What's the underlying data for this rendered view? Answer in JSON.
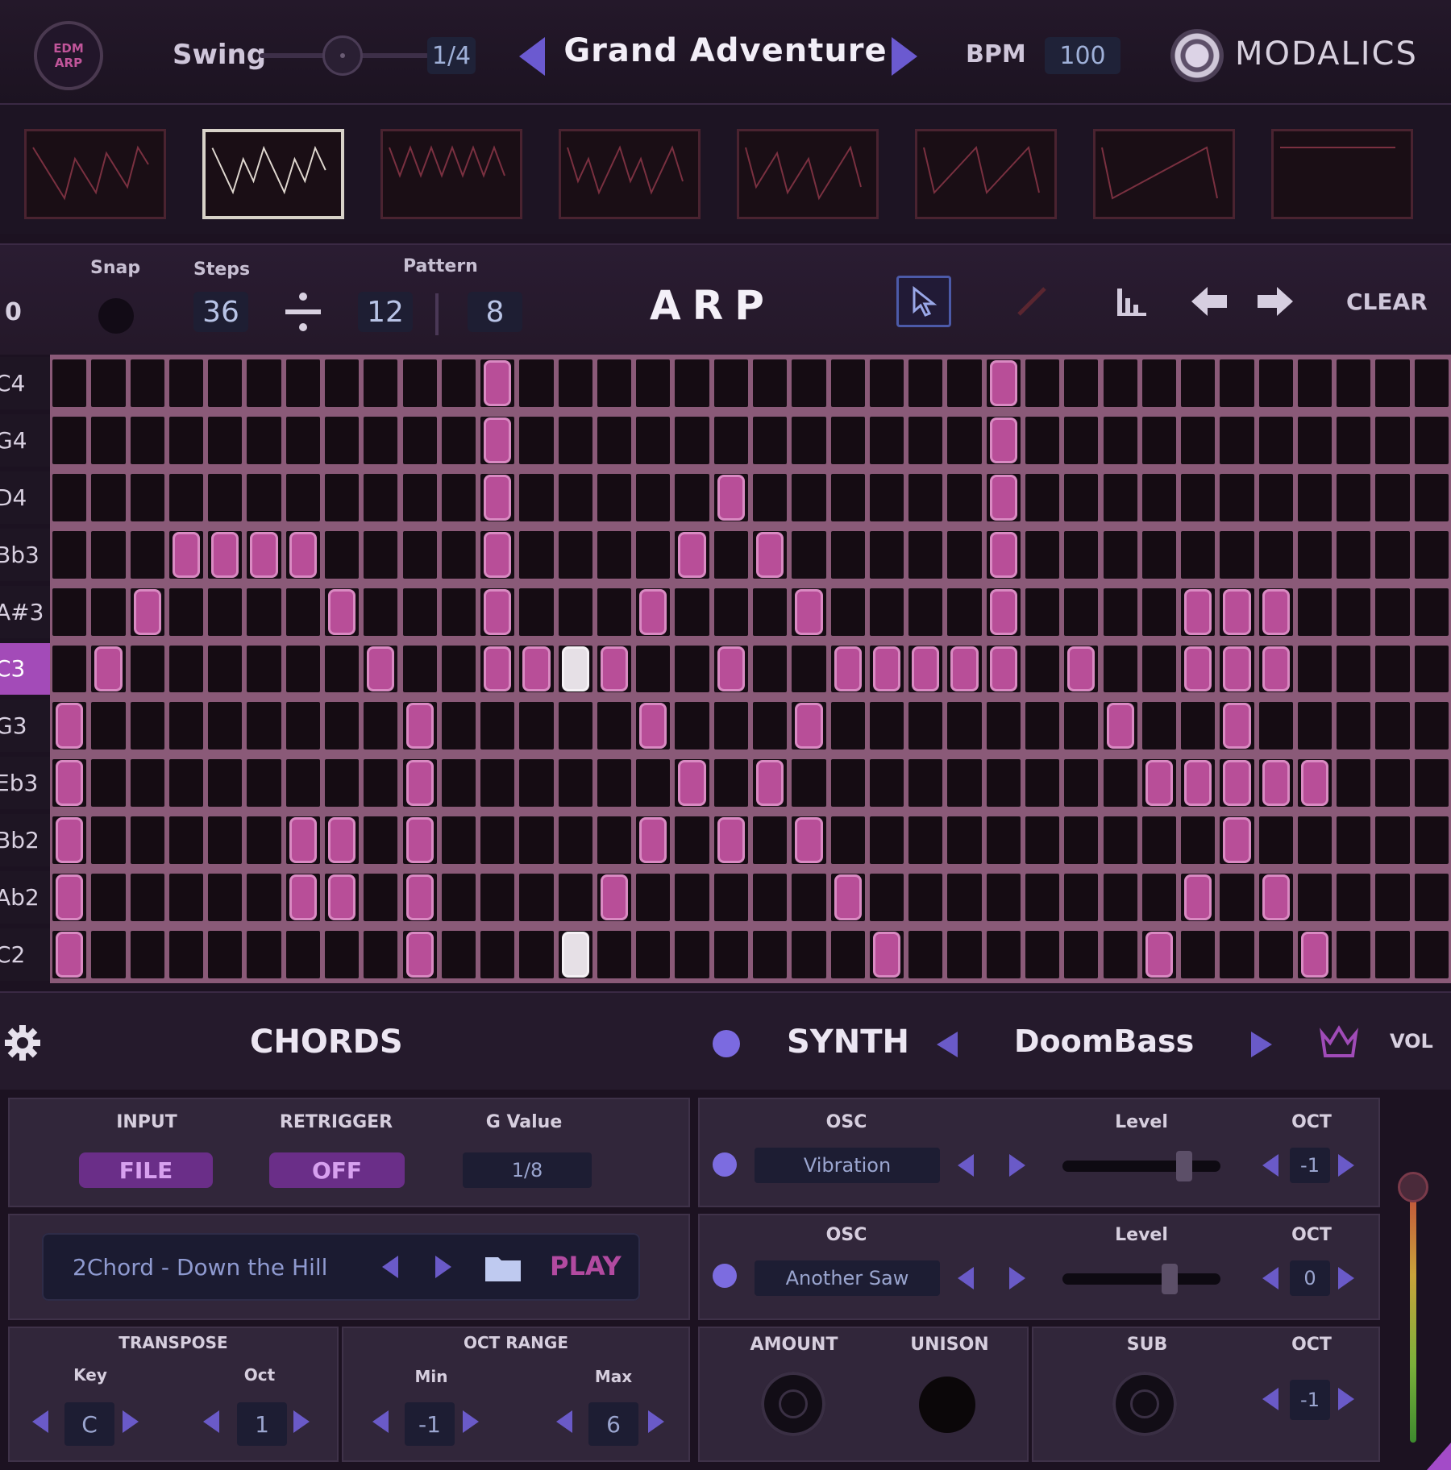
{
  "header": {
    "logo_text": [
      "EDM",
      "ARP"
    ],
    "swing_label": "Swing",
    "swing_value": "1/4",
    "preset_name": "Grand Adventure",
    "bpm_label": "BPM",
    "bpm_value": "100",
    "brand": "MODALICS"
  },
  "toolbar": {
    "left_value": "0",
    "snap_label": "Snap",
    "steps_label": "Steps",
    "steps_value": "36",
    "pattern_label": "Pattern",
    "pattern_a": "12",
    "pattern_b": "8",
    "title": "ARP",
    "clear_label": "CLEAR"
  },
  "pattern_thumbnails": {
    "count": 8,
    "selected_index": 1
  },
  "grid": {
    "columns": 36,
    "rows": [
      "C4",
      "G4",
      "D4",
      "Bb3",
      "A#3",
      "C3",
      "G3",
      "Eb3",
      "Bb2",
      "Ab2",
      "C2"
    ],
    "active_row": 5,
    "notes": [
      [
        0,
        11
      ],
      [
        0,
        24
      ],
      [
        1,
        11
      ],
      [
        1,
        24
      ],
      [
        2,
        11
      ],
      [
        2,
        17
      ],
      [
        2,
        24
      ],
      [
        3,
        3
      ],
      [
        3,
        4
      ],
      [
        3,
        5
      ],
      [
        3,
        6
      ],
      [
        3,
        11
      ],
      [
        3,
        16
      ],
      [
        3,
        18
      ],
      [
        3,
        24
      ],
      [
        4,
        2
      ],
      [
        4,
        7
      ],
      [
        4,
        11
      ],
      [
        4,
        15
      ],
      [
        4,
        19
      ],
      [
        4,
        24
      ],
      [
        4,
        29
      ],
      [
        4,
        30
      ],
      [
        4,
        31
      ],
      [
        5,
        1
      ],
      [
        5,
        8
      ],
      [
        5,
        11
      ],
      [
        5,
        12
      ],
      [
        5,
        13
      ],
      [
        5,
        14
      ],
      [
        5,
        17
      ],
      [
        5,
        20
      ],
      [
        5,
        21
      ],
      [
        5,
        22
      ],
      [
        5,
        23
      ],
      [
        5,
        24
      ],
      [
        5,
        26
      ],
      [
        5,
        29
      ],
      [
        5,
        30
      ],
      [
        5,
        31
      ],
      [
        6,
        0
      ],
      [
        6,
        9
      ],
      [
        6,
        15
      ],
      [
        6,
        19
      ],
      [
        6,
        27
      ],
      [
        6,
        30
      ],
      [
        7,
        0
      ],
      [
        7,
        9
      ],
      [
        7,
        16
      ],
      [
        7,
        18
      ],
      [
        7,
        28
      ],
      [
        7,
        29
      ],
      [
        7,
        30
      ],
      [
        7,
        31
      ],
      [
        7,
        32
      ],
      [
        8,
        0
      ],
      [
        8,
        6
      ],
      [
        8,
        7
      ],
      [
        8,
        9
      ],
      [
        8,
        15
      ],
      [
        8,
        17
      ],
      [
        8,
        19
      ],
      [
        8,
        30
      ],
      [
        9,
        0
      ],
      [
        9,
        6
      ],
      [
        9,
        7
      ],
      [
        9,
        9
      ],
      [
        9,
        14
      ],
      [
        9,
        20
      ],
      [
        9,
        29
      ],
      [
        9,
        31
      ],
      [
        10,
        0
      ],
      [
        10,
        9
      ],
      [
        10,
        13
      ],
      [
        10,
        21
      ],
      [
        10,
        28
      ],
      [
        10,
        32
      ]
    ],
    "selected_notes": [
      [
        5,
        13
      ],
      [
        10,
        13
      ]
    ]
  },
  "sections": {
    "chords_title": "CHORDS",
    "synth_title": "SYNTH",
    "synth_preset": "DoomBass",
    "vol_label": "VOL"
  },
  "chords": {
    "input_label": "INPUT",
    "input_value": "FILE",
    "retrigger_label": "RETRIGGER",
    "retrigger_value": "OFF",
    "gvalue_label": "G Value",
    "gvalue_value": "1/8",
    "file_name": "2Chord - Down the Hill",
    "play_label": "PLAY",
    "transpose_label": "TRANSPOSE",
    "key_label": "Key",
    "key_value": "C",
    "oct_label": "Oct",
    "oct_value": "1",
    "oct_range_label": "OCT RANGE",
    "min_label": "Min",
    "min_value": "-1",
    "max_label": "Max",
    "max_value": "6"
  },
  "synth": {
    "osc1_label": "OSC",
    "osc1_value": "Vibration",
    "osc1_level_label": "Level",
    "osc1_level": 0.8,
    "osc1_oct_label": "OCT",
    "osc1_oct": "-1",
    "osc2_label": "OSC",
    "osc2_value": "Another Saw",
    "osc2_level_label": "Level",
    "osc2_level": 0.7,
    "osc2_oct_label": "OCT",
    "osc2_oct": "0",
    "amount_label": "AMOUNT",
    "unison_label": "UNISON",
    "sub_label": "SUB",
    "sub_oct_label": "OCT",
    "sub_oct": "-1"
  }
}
